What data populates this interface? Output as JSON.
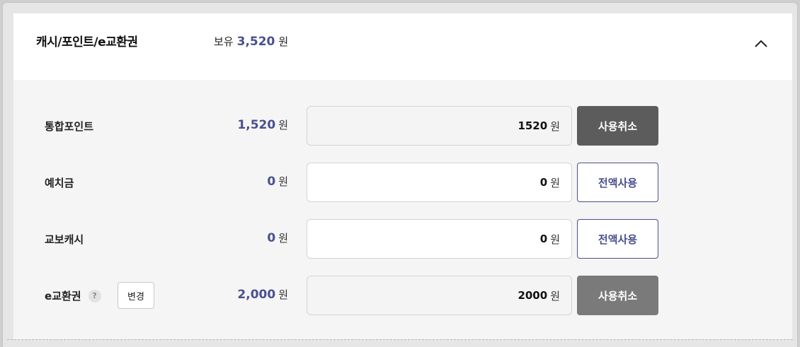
{
  "header": {
    "title": "캐시/포인트/e교환권",
    "balance_label": "보유",
    "balance_value": "3,520",
    "unit": "원"
  },
  "rows": [
    {
      "label": "통합포인트",
      "available": "1,520",
      "unit": "원",
      "amount": "1520",
      "amount_unit": "원",
      "action": "사용취소",
      "has_help": false
    },
    {
      "label": "예치금",
      "available": "0",
      "unit": "원",
      "amount": "0",
      "amount_unit": "원",
      "action": "전액사용",
      "has_help": false
    },
    {
      "label": "교보캐시",
      "available": "0",
      "unit": "원",
      "amount": "0",
      "amount_unit": "원",
      "action": "전액사용",
      "has_help": false
    },
    {
      "label": "e교환권",
      "available": "2,000",
      "unit": "원",
      "amount": "2000",
      "amount_unit": "원",
      "action": "사용취소",
      "has_help": true,
      "help_glyph": "?",
      "change_label": "변경"
    }
  ],
  "icons": {
    "collapse": "chevron-up-icon",
    "help": "question-icon"
  },
  "colors": {
    "accent": "#4a4f8f",
    "cancel_dark": "#5c5c5c",
    "cancel_mid": "#7a7a7a"
  }
}
